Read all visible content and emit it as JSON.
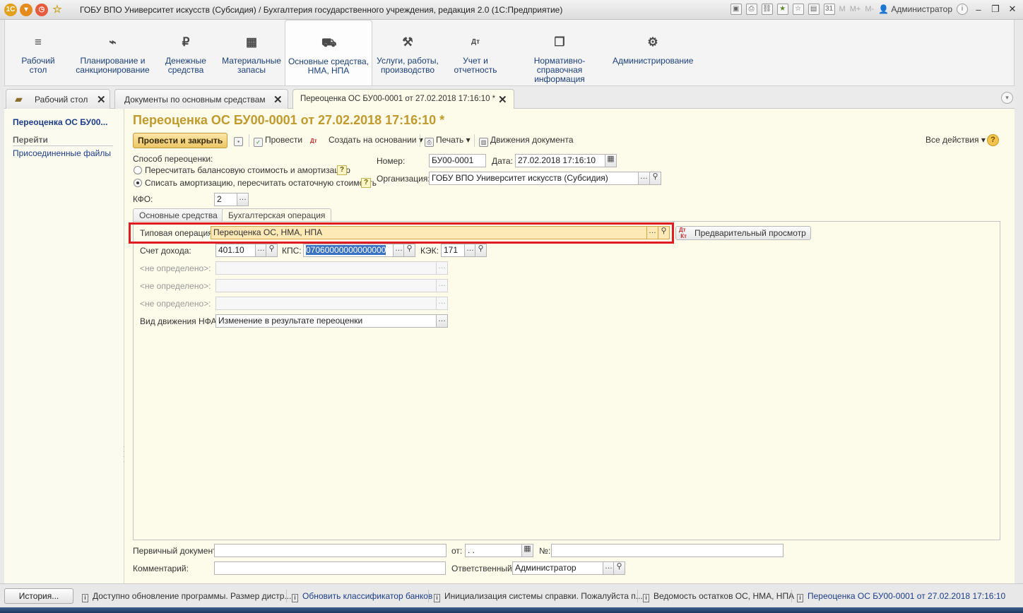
{
  "window": {
    "title": "ГОБУ ВПО Университет искусств (Субсидия) / Бухгалтерия государственного учреждения, редакция 2.0  (1С:Предприятие)",
    "user": "Администратор",
    "m_buttons": [
      "M",
      "M+",
      "M-"
    ]
  },
  "sections": [
    {
      "icon": "menu-icon",
      "glyph": "≡",
      "label": "Рабочий\nстол"
    },
    {
      "icon": "planning-icon",
      "glyph": "⌁",
      "label": "Планирование и\nсанкционирование"
    },
    {
      "icon": "money-icon",
      "glyph": "₽",
      "label": "Денежные\nсредства"
    },
    {
      "icon": "inventory-icon",
      "glyph": "▦",
      "label": "Материальные\nзапасы"
    },
    {
      "icon": "truck-icon",
      "glyph": "⛟",
      "label": "Основные средства,\nНМА, НПА"
    },
    {
      "icon": "tools-icon",
      "glyph": "⚒",
      "label": "Услуги, работы,\nпроизводство"
    },
    {
      "icon": "accounting-icon",
      "glyph": "Дт",
      "label": "Учет и\nотчетность"
    },
    {
      "icon": "reference-icon",
      "glyph": "❐",
      "label": "Нормативно-справочная\nинформация"
    },
    {
      "icon": "gear-icon",
      "glyph": "⚙",
      "label": "Администрирование"
    }
  ],
  "open_tabs": [
    {
      "label": "Рабочий стол"
    },
    {
      "label": "Документы по основным средствам"
    },
    {
      "label": "Переоценка ОС БУ00-0001 от 27.02.2018 17:16:10 *"
    }
  ],
  "left_nav": {
    "title": "Переоценка ОС БУ00...",
    "goto_header": "Перейти",
    "links": [
      "Присоединенные файлы"
    ]
  },
  "document": {
    "title": "Переоценка ОС БУ00-0001 от 27.02.2018 17:16:10 *",
    "toolbar": {
      "post_close": "Провести и закрыть",
      "post": "Провести",
      "create_based": "Создать на основании",
      "print": "Печать",
      "movements": "Движения документа",
      "all_actions": "Все действия"
    },
    "method_label": "Способ переоценки:",
    "method_options": [
      "Пересчитать балансовую стоимость и амортизацию",
      "Списать амортизацию, пересчитать остаточную стоимость"
    ],
    "method_selected_index": 1,
    "kfo_label": "КФО:",
    "kfo_value": "2",
    "number_label": "Номер:",
    "number_value": "БУ00-0001",
    "date_label": "Дата:",
    "date_value": "27.02.2018 17:16:10",
    "org_label": "Организация:",
    "org_value": "ГОБУ ВПО Университет искусств (Субсидия)",
    "tabs": [
      "Основные средства",
      "Бухгалтерская операция"
    ],
    "active_tab_index": 1,
    "operation": {
      "typical_label": "Типовая операция:",
      "typical_value": "Переоценка ОС, НМА, НПА",
      "preview_button": "Предварительный просмотр",
      "income_account_label": "Счет дохода:",
      "income_account_value": "401.10",
      "kps_label": "КПС:",
      "kps_value": "07060000000000000",
      "kek_label": "КЭК:",
      "kek_value": "171",
      "undefined_label": "<не определено>:",
      "nfa_movement_label": "Вид движения НФА:",
      "nfa_movement_value": "Изменение в результате переоценки"
    },
    "footer": {
      "primary_doc_label": "Первичный документ:",
      "from_label": "от:",
      "from_value": " .  .",
      "number_label": "№:",
      "comment_label": "Комментарий:",
      "responsible_label": "Ответственный:",
      "responsible_value": "Администратор"
    }
  },
  "statusbar": {
    "history_button": "История...",
    "items": [
      {
        "text": "Доступно обновление программы. Размер дистр...",
        "link": false
      },
      {
        "text": "Обновить классификатор банков",
        "link": true
      },
      {
        "text": "Инициализация системы справки. Пожалуйста п...",
        "link": false
      },
      {
        "text": "Ведомость остатков ОС, НМА, НПА",
        "link": false
      },
      {
        "text": "Переоценка ОС БУ00-0001 от 27.02.2018 17:16:10",
        "link": true
      }
    ]
  },
  "colors": {
    "doc_title": "#c09a2c",
    "form_bg": "#fdfbe9",
    "highlight_border": "#e11b22",
    "link": "#1b3c87"
  }
}
